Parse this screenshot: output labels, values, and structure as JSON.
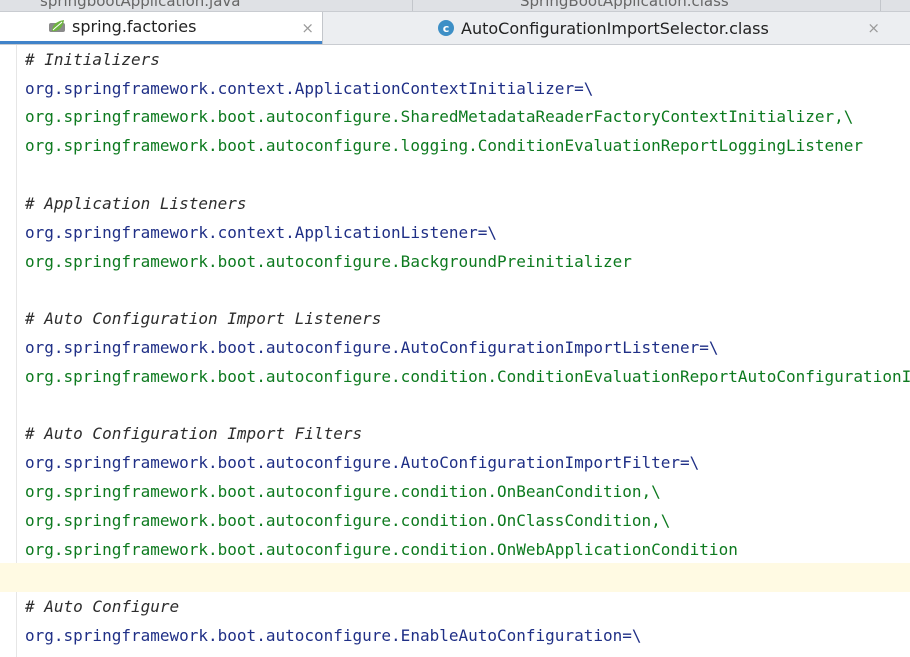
{
  "top_tabs": [
    "springbootApplication.java",
    "SpringBootApplication.class"
  ],
  "tabs": [
    {
      "label": "spring.factories",
      "icon": "spring-leaf-icon",
      "active": true
    },
    {
      "label": "AutoConfigurationImportSelector.class",
      "icon": "class-file-icon",
      "active": false
    }
  ],
  "close_glyph": "×",
  "colors": {
    "comment": "#2d2d2d",
    "key": "#1f2f86",
    "value": "#0d7a1f",
    "tab_accent": "#4083c9",
    "current_line": "#fffae3"
  },
  "lines": [
    {
      "type": "comment",
      "text": "# Initializers"
    },
    {
      "type": "key",
      "text": "org.springframework.context.ApplicationContextInitializer=\\"
    },
    {
      "type": "value",
      "text": "org.springframework.boot.autoconfigure.SharedMetadataReaderFactoryContextInitializer,\\"
    },
    {
      "type": "value",
      "text": "org.springframework.boot.autoconfigure.logging.ConditionEvaluationReportLoggingListener"
    },
    {
      "type": "blank",
      "text": ""
    },
    {
      "type": "comment",
      "text": "# Application Listeners"
    },
    {
      "type": "key",
      "text": "org.springframework.context.ApplicationListener=\\"
    },
    {
      "type": "value",
      "text": "org.springframework.boot.autoconfigure.BackgroundPreinitializer"
    },
    {
      "type": "blank",
      "text": ""
    },
    {
      "type": "comment",
      "text": "# Auto Configuration Import Listeners"
    },
    {
      "type": "key",
      "text": "org.springframework.boot.autoconfigure.AutoConfigurationImportListener=\\"
    },
    {
      "type": "value",
      "text": "org.springframework.boot.autoconfigure.condition.ConditionEvaluationReportAutoConfigurationImportListener"
    },
    {
      "type": "blank",
      "text": ""
    },
    {
      "type": "comment",
      "text": "# Auto Configuration Import Filters"
    },
    {
      "type": "key",
      "text": "org.springframework.boot.autoconfigure.AutoConfigurationImportFilter=\\"
    },
    {
      "type": "value",
      "text": "org.springframework.boot.autoconfigure.condition.OnBeanCondition,\\"
    },
    {
      "type": "value",
      "text": "org.springframework.boot.autoconfigure.condition.OnClassCondition,\\"
    },
    {
      "type": "value",
      "text": "org.springframework.boot.autoconfigure.condition.OnWebApplicationCondition"
    },
    {
      "type": "blank",
      "text": "",
      "current": true
    },
    {
      "type": "comment",
      "text": "# Auto Configure"
    },
    {
      "type": "key",
      "text": "org.springframework.boot.autoconfigure.EnableAutoConfiguration=\\"
    }
  ]
}
